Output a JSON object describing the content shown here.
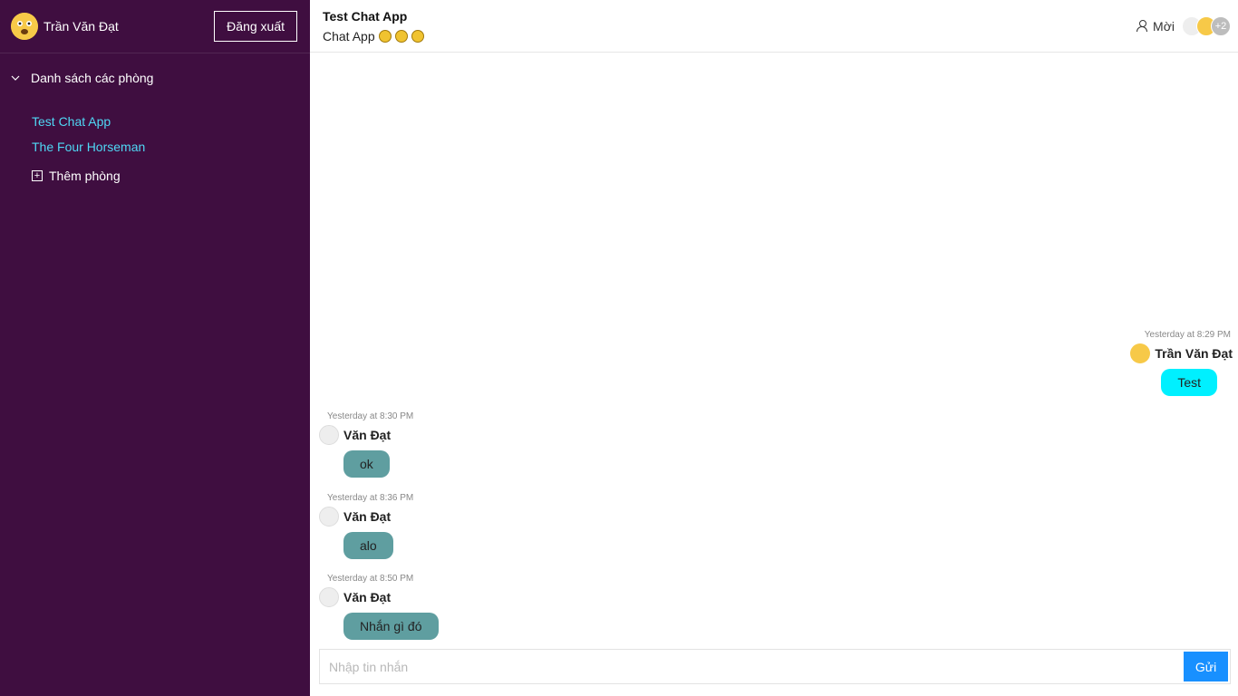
{
  "sidebar": {
    "user_name": "Trần Văn Đạt",
    "logout_label": "Đăng xuất",
    "rooms_header": "Danh sách các phòng",
    "rooms": [
      {
        "label": "Test Chat App"
      },
      {
        "label": "The Four Horseman"
      }
    ],
    "add_room_label": "Thêm phòng"
  },
  "header": {
    "room_title": "Test Chat App",
    "room_desc": "Chat App",
    "invite_label": "Mời",
    "member_count_badge": "+2"
  },
  "messages": [
    {
      "time": "Yesterday at 8:29 PM",
      "author": "Trần Văn Đạt",
      "text": "Test",
      "mine": true
    },
    {
      "time": "Yesterday at 8:30 PM",
      "author": "Văn Đạt",
      "text": "ok",
      "mine": false
    },
    {
      "time": "Yesterday at 8:36 PM",
      "author": "Văn Đạt",
      "text": "alo",
      "mine": false
    },
    {
      "time": "Yesterday at 8:50 PM",
      "author": "Văn Đạt",
      "text": "Nhắn gì đó",
      "mine": false
    }
  ],
  "composer": {
    "placeholder": "Nhập tin nhắn",
    "send_label": "Gửi"
  },
  "colors": {
    "sidebar_bg": "#3f0e40",
    "room_link": "#4fd8f5",
    "mine_bubble": "#00f0ff",
    "other_bubble": "#5f9ea0",
    "send_button": "#1890ff"
  }
}
